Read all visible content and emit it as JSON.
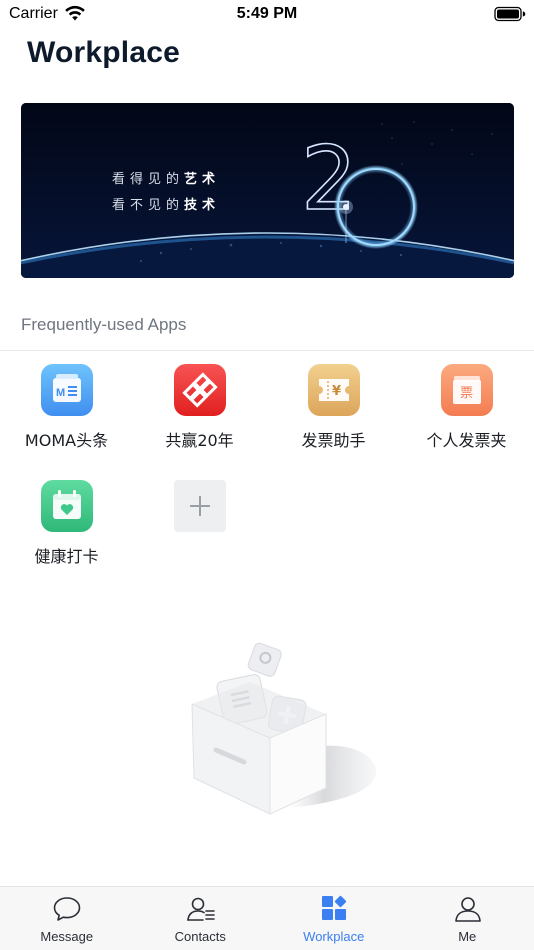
{
  "status_bar": {
    "carrier": "Carrier",
    "time": "5:49 PM",
    "icons": [
      "wifi-icon",
      "battery-icon"
    ]
  },
  "header": {
    "title": "Workplace"
  },
  "banner": {
    "line1_prefix": "看得见的",
    "line1_emphasis": "艺术",
    "line2_prefix": "看不见的",
    "line2_emphasis": "技术",
    "numeral": "20"
  },
  "section": {
    "title": "Frequently-used Apps"
  },
  "apps": [
    {
      "label": "MOMA头条",
      "icon": "news-icon",
      "color": "#5aa8f5"
    },
    {
      "label": "共赢20年",
      "icon": "knot-logo-icon",
      "color": "#ee3a3a"
    },
    {
      "label": "发票助手",
      "icon": "invoice-ticket-icon",
      "color": "#e8b86a"
    },
    {
      "label": "个人发票夹",
      "icon": "invoice-folder-icon",
      "color": "#f7956a"
    },
    {
      "label": "健康打卡",
      "icon": "health-calendar-icon",
      "color": "#3ec98a"
    }
  ],
  "add_app": {
    "icon": "plus-icon"
  },
  "tab_bar": {
    "active": "Workplace",
    "active_color": "#3b7ff0",
    "tabs": [
      {
        "label": "Message",
        "icon": "chat-bubble-icon"
      },
      {
        "label": "Contacts",
        "icon": "contacts-icon"
      },
      {
        "label": "Workplace",
        "icon": "workplace-grid-icon"
      },
      {
        "label": "Me",
        "icon": "person-icon"
      }
    ]
  }
}
